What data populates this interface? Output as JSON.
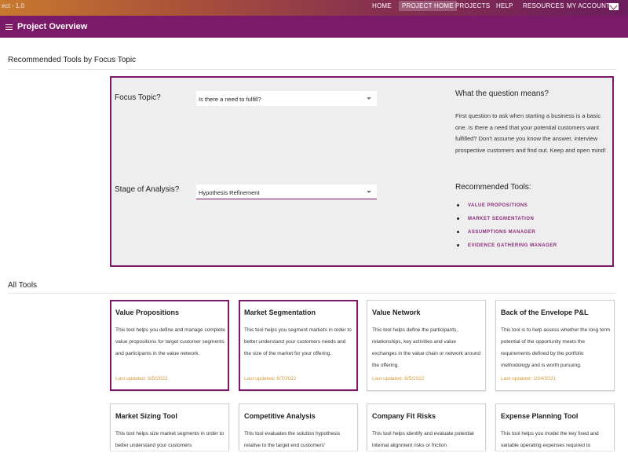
{
  "app": {
    "version": "ect - 1.0"
  },
  "topnav": {
    "items": [
      {
        "label": "HOME",
        "active": false
      },
      {
        "label": "PROJECT HOME",
        "active": true
      },
      {
        "label": "PROJECTS",
        "active": false
      },
      {
        "label": "HELP",
        "active": false
      },
      {
        "label": "RESOURCES",
        "active": false
      },
      {
        "label": "MY ACCOUNT",
        "active": false
      }
    ],
    "mail_icon": "envelope-icon"
  },
  "header": {
    "title": "Project Overview",
    "menu_icon": "hamburger-menu-icon"
  },
  "recommended": {
    "section_title": "Recommended Tools by Focus Topic",
    "focus_label": "Focus Topic?",
    "focus_value": "Is there a need to fulfill?",
    "stage_label": "Stage of Analysis?",
    "stage_value": "Hypothesis Refinement",
    "question_title": "What the question means?",
    "question_text": "First question to ask when starting a business is a basic one. Is there a need that your potential customers want fulfilled? Don't assume you know the answer, interview prospective customers and find out. Keep and open mind!",
    "rec_title": "Recommended Tools:",
    "rec_items": [
      "VALUE PROPOSITIONS",
      "MARKET SEGMENTATION",
      "ASSUMPTIONS MANAGER",
      "EVIDENCE GATHERING MANAGER"
    ]
  },
  "all_tools": {
    "section_title": "All Tools",
    "cards": [
      {
        "title": "Value Propositions",
        "desc": "This tool helps you define and manage complete value propositions for target customer segments and participants in the value network.",
        "updated": "Last updated: 6/5/2022",
        "selected": true
      },
      {
        "title": "Market Segmentation",
        "desc": "This tool helps you segment markets in order to better understand your customers needs and the size of the market for your offering.",
        "updated": "Last updated: 6/7/2022",
        "selected": true
      },
      {
        "title": "Value Network",
        "desc": "This tool helps define the participants, relationships, key activities and value exchanges in the value chain or network around the offering.",
        "updated": "Last updated: 6/5/2022",
        "selected": false
      },
      {
        "title": "Back of the Envelope P&L",
        "desc": "This tool is to help assess whether the long term potential of the opportunity meets the requirements defined by the portfolio methodology and is worth pursuing.",
        "updated": "Last updated: 10/4/2021",
        "selected": false
      },
      {
        "title": "Market Sizing Tool",
        "desc": "This tool helps size market segments in order to better understand your customers",
        "updated": "",
        "selected": false
      },
      {
        "title": "Competitive Analysis",
        "desc": "This tool evaluates the solution hypothesis relative to the target end customers'",
        "updated": "",
        "selected": false
      },
      {
        "title": "Company Fit Risks",
        "desc": "This tool helps identify and evaluate potential internal alignment risks or friction",
        "updated": "",
        "selected": false
      },
      {
        "title": "Expense Planning Tool",
        "desc": "This tool helps you model the key fixed and variable operating expenses required to",
        "updated": "",
        "selected": false
      }
    ]
  }
}
